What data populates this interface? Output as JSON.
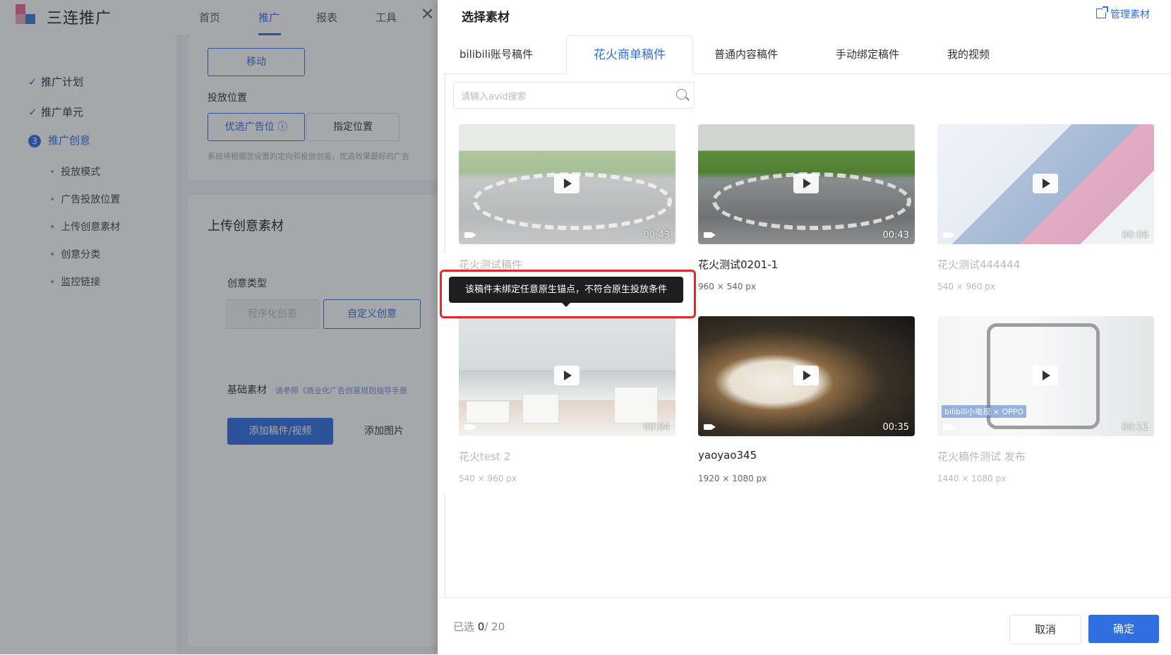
{
  "app": {
    "brand": "三连推广",
    "nav": [
      "首页",
      "推广",
      "报表",
      "工具"
    ],
    "close_symbol": "✕",
    "steps": [
      {
        "mark": "✓",
        "label": "推广计划"
      },
      {
        "mark": "✓",
        "label": "推广单元"
      },
      {
        "mark": "3",
        "label": "推广创意"
      }
    ],
    "sub_steps": [
      "投放模式",
      "广告投放位置",
      "上传创意素材",
      "创意分类",
      "监控链接"
    ],
    "move_button": "移动",
    "placement_label": "投放位置",
    "preferred_button": "优选广告位 ⓘ",
    "specific_button": "指定位置",
    "placement_hint": "系统将根据您设置的定向和投放创意，优选效果最好的广告",
    "upload_title": "上传创意素材",
    "creative_type_label": "创意类型",
    "programmatic_button": "程序化创意",
    "custom_button": "自定义创意",
    "basic_material_label": "基础素材",
    "basic_material_hint": "请参照《商业化广告创意规则指导手册",
    "add_video_button": "添加稿件/视频",
    "add_image_button": "添加图片"
  },
  "drawer": {
    "title": "选择素材",
    "manage_link": "管理素材",
    "tabs": [
      "bilibili账号稿件",
      "花火商单稿件",
      "普通内容稿件",
      "手动绑定稿件",
      "我的视频"
    ],
    "active_tab_index": 1,
    "search_placeholder": "请输入avid搜索",
    "cards": [
      {
        "title": "花火测试稿件",
        "size": "",
        "duration": "00:43",
        "thumb": "track",
        "disabled": true
      },
      {
        "title": "花火测试0201-1",
        "size": "960 × 540 px",
        "duration": "00:43",
        "thumb": "track",
        "disabled": false
      },
      {
        "title": "花火测试444444",
        "size": "540 × 960 px",
        "duration": "00:06",
        "thumb": "bag",
        "disabled": true
      },
      {
        "title": "花火test 2",
        "size": "540 × 960 px",
        "duration": "00:04",
        "thumb": "city",
        "disabled": true
      },
      {
        "title": "yaoyao345",
        "size": "1920 × 1080 px",
        "duration": "00:35",
        "thumb": "cat",
        "disabled": false
      },
      {
        "title": "花火稿件测试 发布",
        "size": "1440 × 1080 px",
        "duration": "00:11",
        "thumb": "box",
        "disabled": true
      }
    ],
    "thumb_watermark": "bilibili小电视 × OPPO",
    "tooltip": "该稿件未绑定任意原生锚点，不符合原生投放条件",
    "selected_prefix": "已选 ",
    "selected_count": "0",
    "selected_total": "/ 20",
    "cancel_button": "取消",
    "ok_button": "确定"
  },
  "colors": {
    "accent": "#2f6fe0",
    "highlight_border": "#e02a2a",
    "tooltip_bg": "#1e1e1e"
  },
  "icons": [
    "logo-icon",
    "close-icon",
    "check-icon",
    "external-link-icon",
    "search-icon",
    "play-icon",
    "video-camera-icon"
  ]
}
